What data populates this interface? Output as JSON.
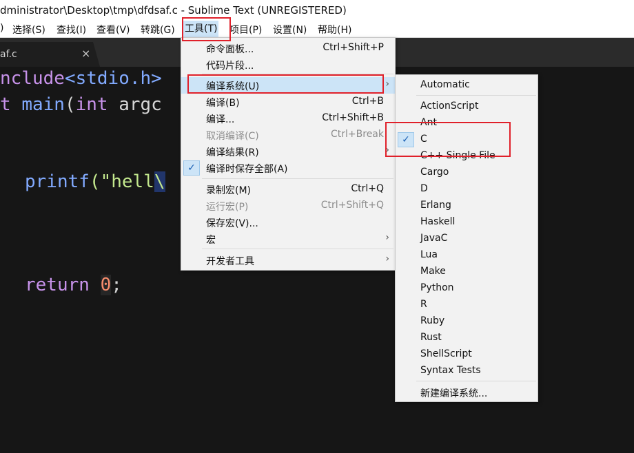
{
  "window": {
    "title": "dministrator\\Desktop\\tmp\\dfdsaf.c - Sublime Text (UNREGISTERED)"
  },
  "menubar": {
    "items": [
      {
        "label": ")"
      },
      {
        "label": "选择(S)"
      },
      {
        "label": "查找(I)"
      },
      {
        "label": "查看(V)"
      },
      {
        "label": "转跳(G)"
      },
      {
        "label": "工具(T)"
      },
      {
        "label": "项目(P)"
      },
      {
        "label": "设置(N)"
      },
      {
        "label": "帮助(H)"
      }
    ]
  },
  "tab": {
    "name": "af.c",
    "close": "×"
  },
  "code": {
    "line1": {
      "a": "nclude",
      "b": "<stdio.h>"
    },
    "line2": {
      "a": "t",
      "b": "main",
      "c": "(",
      "d": "int",
      "e": "argc"
    },
    "line3": {
      "a": "printf",
      "b": "(\"hell",
      "c": "\\"
    },
    "line4": {
      "a": "return",
      "b": "0",
      "c": ";"
    }
  },
  "tools_menu": {
    "items": [
      {
        "label": "命令面板...",
        "shortcut": "Ctrl+Shift+P"
      },
      {
        "label": "代码片段..."
      },
      {
        "label": "编译系统(U)",
        "arrow": "›"
      },
      {
        "label": "编译(B)",
        "shortcut": "Ctrl+B"
      },
      {
        "label": "编译...",
        "shortcut": "Ctrl+Shift+B"
      },
      {
        "label": "取消编译(C)",
        "shortcut": "Ctrl+Break"
      },
      {
        "label": "编译结果(R)",
        "arrow": "›"
      },
      {
        "label": "编译时保存全部(A)",
        "check": "✓"
      },
      {
        "label": "录制宏(M)",
        "shortcut": "Ctrl+Q"
      },
      {
        "label": "运行宏(P)",
        "shortcut": "Ctrl+Shift+Q"
      },
      {
        "label": "保存宏(V)..."
      },
      {
        "label": "宏",
        "arrow": "›"
      },
      {
        "label": "开发者工具",
        "arrow": "›"
      }
    ]
  },
  "build_submenu": {
    "items": [
      {
        "label": "Automatic"
      },
      {
        "label": "ActionScript"
      },
      {
        "label": "Ant"
      },
      {
        "label": "C",
        "check": "✓"
      },
      {
        "label": "C++ Single File"
      },
      {
        "label": "Cargo"
      },
      {
        "label": "D"
      },
      {
        "label": "Erlang"
      },
      {
        "label": "Haskell"
      },
      {
        "label": "JavaC"
      },
      {
        "label": "Lua"
      },
      {
        "label": "Make"
      },
      {
        "label": "Python"
      },
      {
        "label": "R"
      },
      {
        "label": "Ruby"
      },
      {
        "label": "Rust"
      },
      {
        "label": "ShellScript"
      },
      {
        "label": "Syntax Tests"
      },
      {
        "label": "新建编译系统..."
      }
    ]
  },
  "colors": {
    "highlight": "#cce4f7",
    "annotation": "#e0202a",
    "editor_bg": "#161616"
  }
}
